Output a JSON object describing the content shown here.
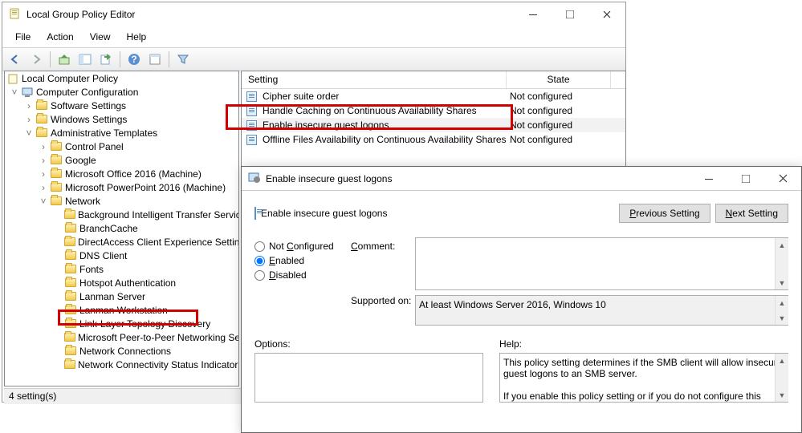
{
  "main_window": {
    "title": "Local Group Policy Editor",
    "menus": [
      "File",
      "Action",
      "View",
      "Help"
    ],
    "status": "4 setting(s)"
  },
  "tree": {
    "root": "Local Computer Policy",
    "comp_config": "Computer Configuration",
    "items": [
      "Software Settings",
      "Windows Settings",
      "Administrative Templates"
    ],
    "admin": [
      "Control Panel",
      "Google",
      "Microsoft Office 2016 (Machine)",
      "Microsoft PowerPoint 2016 (Machine)",
      "Network"
    ],
    "network": [
      "Background Intelligent Transfer Service",
      "BranchCache",
      "DirectAccess Client Experience Settings",
      "DNS Client",
      "Fonts",
      "Hotspot Authentication",
      "Lanman Server",
      "Lanman Workstation",
      "Link-Layer Topology Discovery",
      "Microsoft Peer-to-Peer Networking Services",
      "Network Connections",
      "Network Connectivity Status Indicator"
    ]
  },
  "list": {
    "headers": {
      "setting": "Setting",
      "state": "State"
    },
    "rows": [
      {
        "name": "Cipher suite order",
        "state": "Not configured"
      },
      {
        "name": "Handle Caching on Continuous Availability Shares",
        "state": "Not configured"
      },
      {
        "name": "Enable insecure guest logons",
        "state": "Not configured"
      },
      {
        "name": "Offline Files Availability on Continuous Availability Shares",
        "state": "Not configured"
      }
    ]
  },
  "dialog": {
    "title": "Enable insecure guest logons",
    "header": "Enable insecure guest logons",
    "prev": "Previous Setting",
    "next": "Next Setting",
    "opt_notconf": "Not Configured",
    "opt_enabled": "Enabled",
    "opt_disabled": "Disabled",
    "comment_label": "Comment:",
    "supported_label": "Supported on:",
    "supported": "At least Windows Server 2016, Windows 10",
    "options_label": "Options:",
    "help_label": "Help:",
    "help_text": "This policy setting determines if the SMB client will allow insecure guest logons to an SMB server.\n\nIf you enable this policy setting or if you do not configure this"
  }
}
